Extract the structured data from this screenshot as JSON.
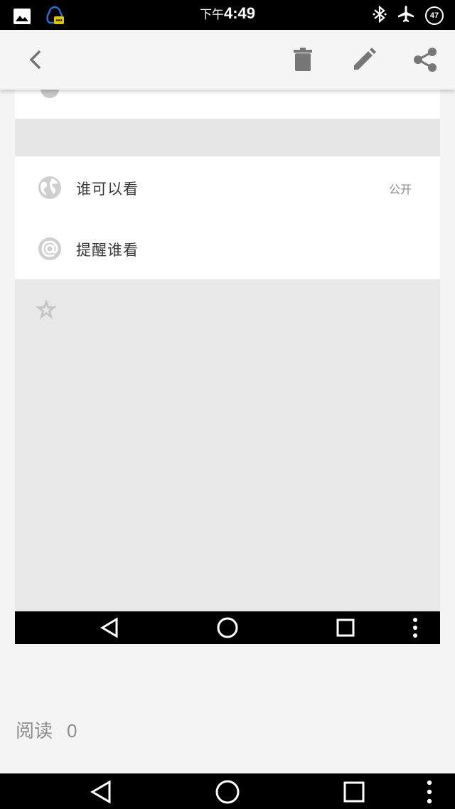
{
  "status_bar": {
    "time_prefix": "下午",
    "time": "4:49",
    "battery_level": "47",
    "icons": [
      "gallery-icon",
      "qq-message-icon",
      "bluetooth-icon",
      "airplane-mode-icon",
      "battery-icon"
    ]
  },
  "toolbar": {
    "icons": [
      "back-icon",
      "delete-icon",
      "edit-icon",
      "share-icon"
    ]
  },
  "screenshot": {
    "card_rows": [
      {
        "icon": "globe-icon",
        "label": "谁可以看",
        "value": "公开"
      },
      {
        "icon": "at-icon",
        "label": "提醒谁看",
        "value": ""
      }
    ],
    "extra_icon": "star-icon",
    "nav_icons": [
      "back-triangle-icon",
      "home-circle-icon",
      "recents-square-icon",
      "more-dots-icon"
    ]
  },
  "read": {
    "label": "阅读",
    "count": "0"
  },
  "nav_bar": {
    "icons": [
      "back-triangle-icon",
      "home-circle-icon",
      "recents-square-icon",
      "more-dots-icon"
    ]
  }
}
